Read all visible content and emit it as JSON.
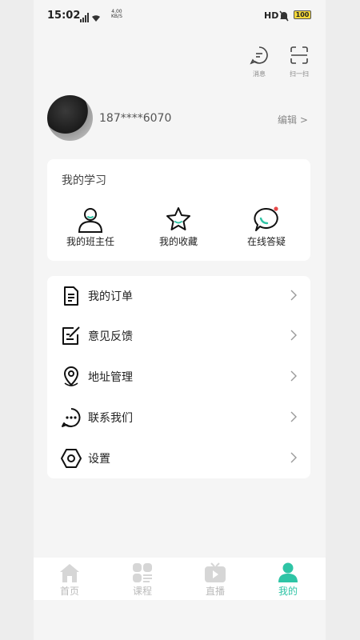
{
  "status_bar": {
    "time": "15:02",
    "net_speed_value": "4.00",
    "net_speed_unit": "KB/S",
    "hd": "HD",
    "battery": "100"
  },
  "top_actions": {
    "message_label": "消息",
    "scan_label": "扫一扫"
  },
  "profile": {
    "phone": "187****6070",
    "edit_label": "编辑 >"
  },
  "learning": {
    "title": "我的学习",
    "items": [
      {
        "label": "我的班主任",
        "icon": "person-icon"
      },
      {
        "label": "我的收藏",
        "icon": "star-icon"
      },
      {
        "label": "在线答疑",
        "icon": "chat-bubble-icon"
      }
    ]
  },
  "menu": {
    "items": [
      {
        "label": "我的订单",
        "icon": "document-icon"
      },
      {
        "label": "意见反馈",
        "icon": "feedback-edit-icon"
      },
      {
        "label": "地址管理",
        "icon": "location-pin-icon"
      },
      {
        "label": "联系我们",
        "icon": "chat-dots-icon"
      },
      {
        "label": "设置",
        "icon": "settings-hexagon-icon"
      }
    ]
  },
  "tabbar": {
    "tabs": [
      {
        "label": "首页",
        "icon": "home-icon",
        "active": false
      },
      {
        "label": "课程",
        "icon": "grid-icon",
        "active": false
      },
      {
        "label": "直播",
        "icon": "tv-play-icon",
        "active": false
      },
      {
        "label": "我的",
        "icon": "user-icon",
        "active": true
      }
    ]
  },
  "colors": {
    "accent": "#2ec4a5",
    "background": "#f5f5f5",
    "card": "#ffffff",
    "notification_dot": "#e84a4a"
  }
}
